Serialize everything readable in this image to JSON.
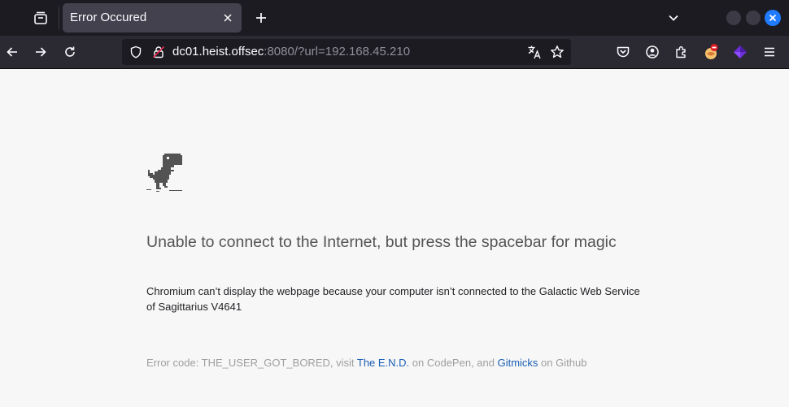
{
  "browser": {
    "tab": {
      "title": "Error Occured"
    },
    "url": {
      "host": "dc01.heist.offsec",
      "rest": ":8080/?url=192.168.45.210"
    }
  },
  "page": {
    "headline": "Unable to connect to the Internet, but press the spacebar for magic",
    "description": "Chromium can’t display the webpage because your computer isn’t connected to the Galactic Web Service of Sagittarius V4641",
    "error": {
      "prefix": "Error code: THE_USER_GOT_BORED, visit ",
      "link1": "The E.N.D.",
      "middle": " on CodePen, and ",
      "link2": "Gitmicks",
      "suffix": " on Github"
    }
  },
  "colors": {
    "tabstrip": "#1c1b22",
    "navbar": "#2b2a33",
    "page_bg": "#f7f7f7",
    "link": "#1a5fb4",
    "dino": "#535353"
  },
  "icons": [
    "tab-list-icon",
    "close-icon",
    "plus-icon",
    "chevron-down-icon",
    "back-arrow-icon",
    "forward-arrow-icon",
    "reload-icon",
    "shield-icon",
    "insecure-lock-icon",
    "translate-icon",
    "star-icon",
    "pocket-icon",
    "account-icon",
    "extensions-icon",
    "extension-badge-icon",
    "extension-cube-icon",
    "hamburger-menu-icon",
    "dino-icon"
  ]
}
